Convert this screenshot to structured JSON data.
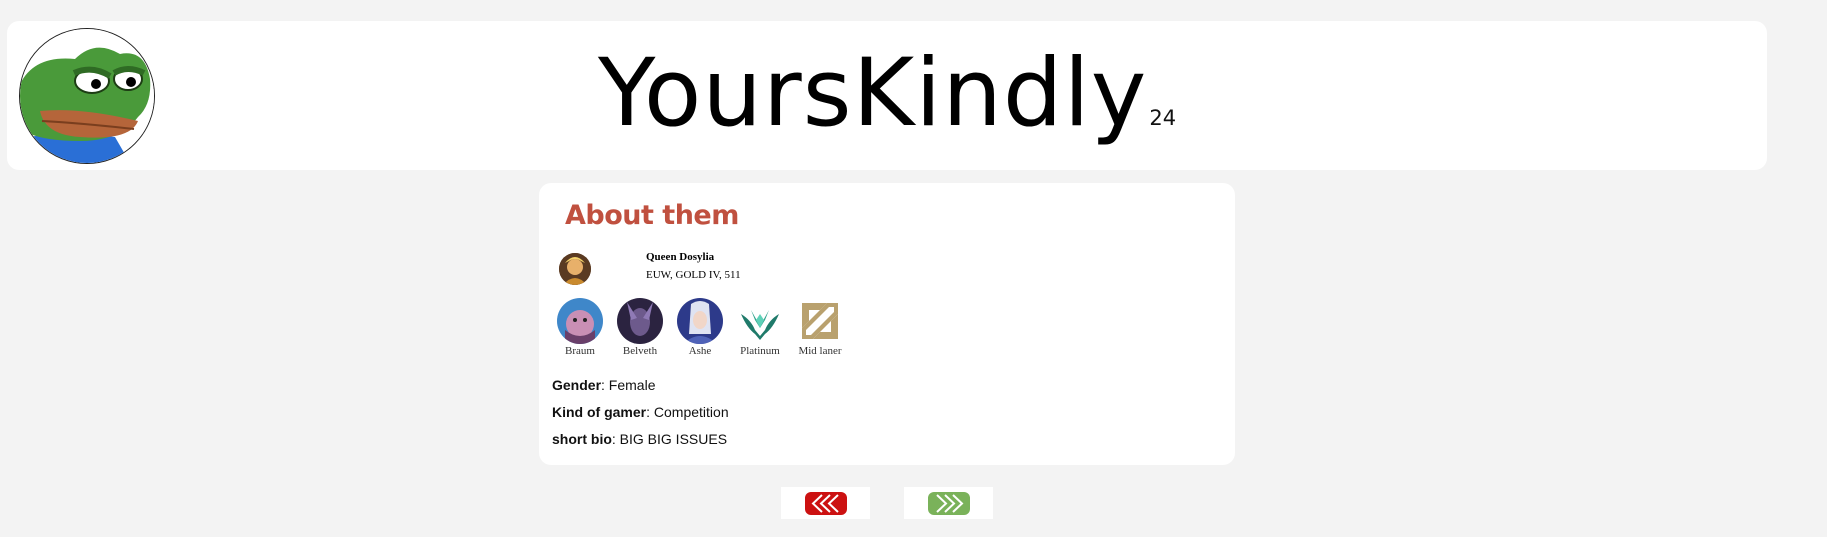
{
  "header": {
    "title": "YoursKindly",
    "superscript": "24",
    "logo_icon": "frog-avatar-icon"
  },
  "card": {
    "heading": "About them",
    "heading_color": "#c0503f",
    "profile": {
      "name": "Queen Dosylia",
      "details": "EUW, GOLD IV, 511"
    },
    "badges": [
      {
        "label": "Braum",
        "icon": "braum-champion-icon"
      },
      {
        "label": "Belveth",
        "icon": "belveth-champion-icon"
      },
      {
        "label": "Ashe",
        "icon": "ashe-champion-icon"
      },
      {
        "label": "Platinum",
        "icon": "platinum-rank-icon"
      },
      {
        "label": "Mid laner",
        "icon": "mid-lane-icon"
      }
    ],
    "info": [
      {
        "key": "Gender",
        "value": ": Female"
      },
      {
        "key": "Kind of gamer",
        "value": ": Competition"
      },
      {
        "key": "short bio",
        "value": ": BIG BIG ISSUES"
      }
    ]
  },
  "nav": {
    "prev_color": "#cc1111",
    "next_color": "#7ab25a",
    "prev_icon": "chevrons-left-icon",
    "next_icon": "chevrons-right-icon"
  }
}
